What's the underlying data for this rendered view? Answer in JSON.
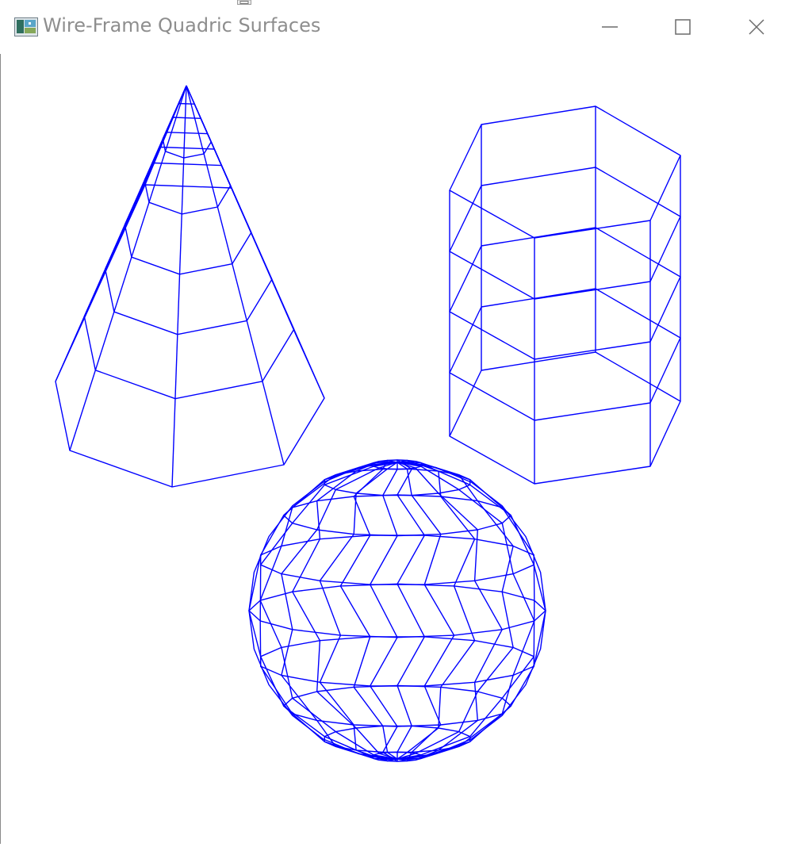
{
  "window": {
    "title": "Wire-Frame Quadric Surfaces",
    "icon": "application-icon",
    "controls": [
      "minimize-icon",
      "maximize-icon",
      "close-icon"
    ]
  },
  "scene": {
    "background": "#ffffff",
    "line_color": "#0000ff",
    "objects": [
      {
        "name": "cone",
        "style": "wireframe"
      },
      {
        "name": "cylinder",
        "style": "wireframe"
      },
      {
        "name": "sphere",
        "style": "wireframe"
      }
    ]
  }
}
